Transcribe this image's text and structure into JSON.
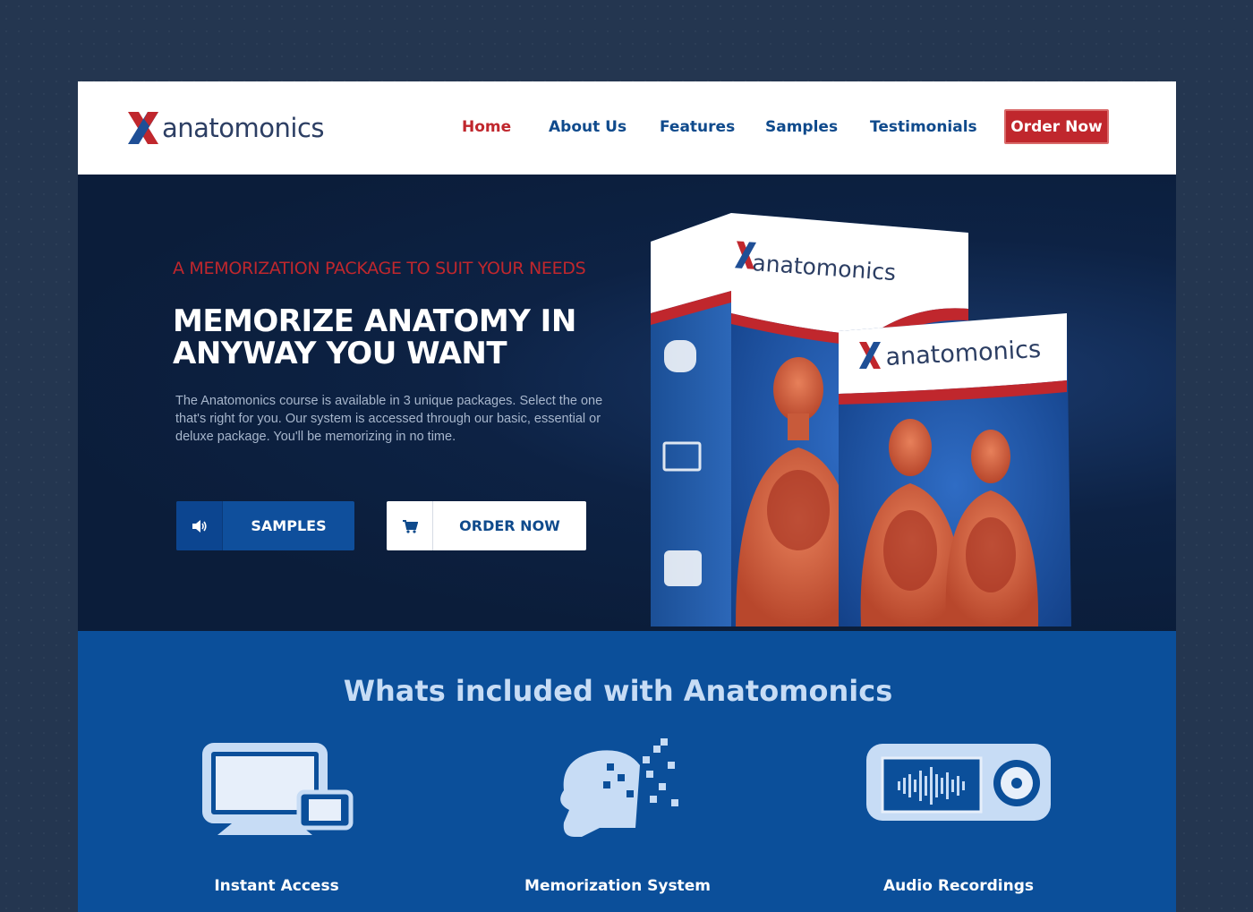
{
  "brand": {
    "name": "anatomonics"
  },
  "nav": {
    "items": [
      {
        "label": "Home",
        "active": true
      },
      {
        "label": "About Us"
      },
      {
        "label": "Features"
      },
      {
        "label": "Samples"
      },
      {
        "label": "Testimonials"
      }
    ],
    "order_label": "Order Now"
  },
  "hero": {
    "kicker": "A MEMORIZATION PACKAGE TO SUIT YOUR NEEDS",
    "title": "MEMORIZE ANATOMY IN ANYWAY YOU WANT",
    "description": "The Anatomonics course is available in 3 unique packages. Select the one that's right for you. Our system is accessed through our basic, essential or deluxe package. You'll be memorizing in no time.",
    "samples_button": {
      "label": "SAMPLES",
      "icon": "speaker-icon"
    },
    "order_button": {
      "label": "ORDER NOW",
      "icon": "cart-icon"
    },
    "product_image": {
      "box_brand": "anatomonics"
    }
  },
  "features": {
    "title": "Whats included with Anatomonics",
    "items": [
      {
        "label": "Instant Access",
        "icon": "devices-icon"
      },
      {
        "label": "Memorization System",
        "icon": "brain-head-icon"
      },
      {
        "label": "Audio Recordings",
        "icon": "audio-player-icon"
      }
    ]
  },
  "colors": {
    "background": "#243650",
    "brand_red": "#c0272d",
    "brand_blue": "#0f4a8c",
    "hero_bg": "#0b1d3a",
    "features_bg": "#0b4f9a",
    "features_title": "#c7dcf5"
  }
}
